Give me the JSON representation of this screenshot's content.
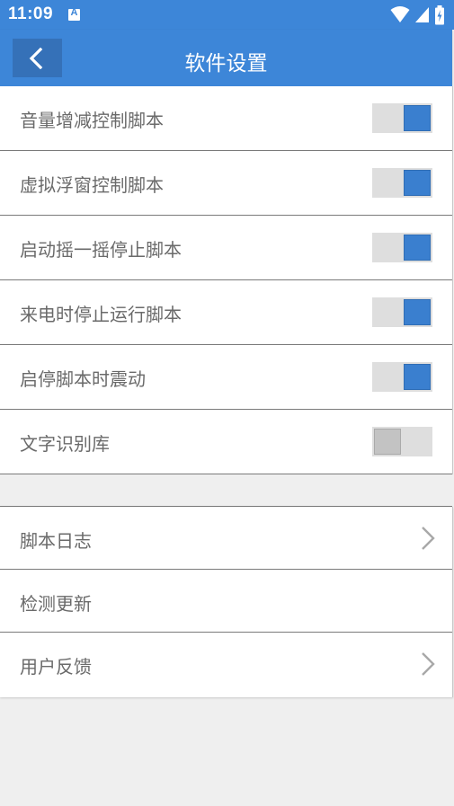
{
  "status": {
    "time": "11:09",
    "notif_letter": "A"
  },
  "header": {
    "title": "软件设置"
  },
  "settings": [
    {
      "label": "音量增减控制脚本",
      "on": true
    },
    {
      "label": "虚拟浮窗控制脚本",
      "on": true
    },
    {
      "label": "启动摇一摇停止脚本",
      "on": true
    },
    {
      "label": "来电时停止运行脚本",
      "on": true
    },
    {
      "label": "启停脚本时震动",
      "on": true
    },
    {
      "label": "文字识别库",
      "on": false
    }
  ],
  "nav": [
    {
      "label": "脚本日志",
      "chevron": true
    },
    {
      "label": "检测更新",
      "chevron": false
    },
    {
      "label": "用户反馈",
      "chevron": true
    }
  ],
  "colors": {
    "accent": "#3d86d8",
    "toggle_on": "#3a7fcf",
    "toggle_off": "#c3c3c3"
  },
  "icons": {
    "back": "chevron-left-icon",
    "wifi": "wifi-icon",
    "signal": "signal-icon",
    "battery": "battery-charging-icon"
  }
}
